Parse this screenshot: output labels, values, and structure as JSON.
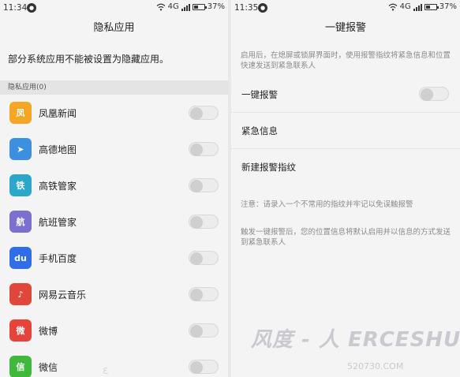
{
  "left": {
    "status": {
      "time": "11:34",
      "net": "4G",
      "battery": "37%"
    },
    "title": "隐私应用",
    "intro": "部分系统应用不能被设置为隐藏应用。",
    "section": "隐私应用(0)",
    "apps": [
      {
        "name": "凤凰新闻",
        "icon": "ifeng-news-icon",
        "color": "#f5a623",
        "glyph": "凤",
        "on": false
      },
      {
        "name": "高德地图",
        "icon": "amap-icon",
        "color": "#3d8fe0",
        "glyph": "➤",
        "on": false
      },
      {
        "name": "高铁管家",
        "icon": "gaotie-icon",
        "color": "#2aa7c9",
        "glyph": "铁",
        "on": false
      },
      {
        "name": "航班管家",
        "icon": "hangban-icon",
        "color": "#7b6fd0",
        "glyph": "航",
        "on": false
      },
      {
        "name": "手机百度",
        "icon": "baidu-icon",
        "color": "#2f6ee8",
        "glyph": "du",
        "on": false
      },
      {
        "name": "网易云音乐",
        "icon": "netease-music-icon",
        "color": "#e0473a",
        "glyph": "♪",
        "on": false
      },
      {
        "name": "微博",
        "icon": "weibo-icon",
        "color": "#e8433a",
        "glyph": "微",
        "on": false
      },
      {
        "name": "微信",
        "icon": "wechat-icon",
        "color": "#3fb83b",
        "glyph": "信",
        "on": false
      }
    ]
  },
  "right": {
    "status": {
      "time": "11:35",
      "net": "4G",
      "battery": "37%"
    },
    "title": "一键报警",
    "desc": "启用后，在熄屏或锁屏界面时，使用报警指纹将紧急信息和位置快速发送到紧急联系人",
    "rows": {
      "alarm": "一键报警",
      "emergency_info": "紧急信息",
      "new_fingerprint": "新建报警指纹"
    },
    "note1": "注意：请录入一个不常用的指纹并牢记以免误触报警",
    "note2": "触发一键报警后，您的位置信息将默认启用并以信息的方式发送到紧急联系人",
    "alarm_on": false
  },
  "watermark": {
    "main": "风度 - 人 ERCESHUO.COM",
    "sub": "520730.COM"
  }
}
